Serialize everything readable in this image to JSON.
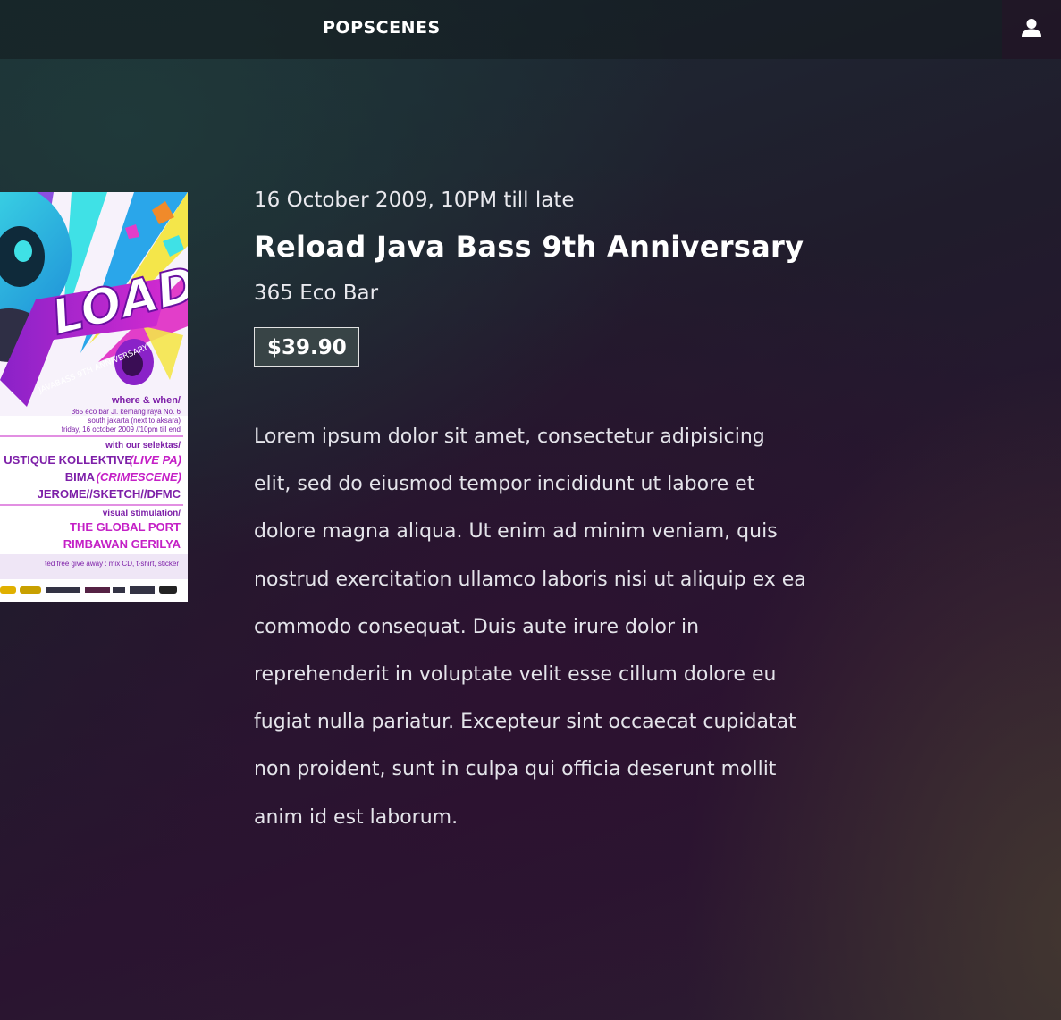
{
  "header": {
    "brand": "POPSCENES",
    "user_icon": "user-icon"
  },
  "event": {
    "date": "16 October 2009, 10PM till late",
    "title": "Reload Java Bass 9th Anniversary",
    "venue": "365 Eco Bar",
    "price": "$39.90",
    "description": "Lorem ipsum dolor sit amet, consectetur adipisicing elit, sed do eiusmod tempor incididunt ut labore et dolore magna aliqua. Ut enim ad minim veniam, quis nostrud exercitation ullamco laboris nisi ut aliquip ex ea commodo consequat. Duis aute irure dolor in reprehenderit in voluptate velit esse cillum dolore eu fugiat nulla pariatur. Excepteur sint occaecat cupidatat non proident, sunt in culpa qui officia deserunt mollit anim id est laborum."
  },
  "poster": {
    "headline": "LOAD",
    "subtitle": "JAVABASS 9TH ANNIVERSARY",
    "where_when_label": "where & when/",
    "where_line1": "365 eco bar Jl. kemang raya No. 6",
    "where_line2": "south jakarta (next to aksara)",
    "where_line3": "friday, 16 october 2009 //10pm till end",
    "selektas_label": "with our selektas/",
    "selekta_1": "USTIQUE KOLLEKTIVE",
    "selekta_1_note": "(LIVE PA)",
    "selekta_2": "BIMA",
    "selekta_2_note": "(CRIMESCENE)",
    "selekta_3": "JEROME//SKETCH//DFMC",
    "visual_label": "visual stimulation/",
    "visual_1": "THE GLOBAL PORT",
    "visual_2": "RIMBAWAN GERILYA",
    "giveaway": "ted free give away : mix CD, t-shirt, sticker",
    "colors": {
      "magenta": "#c41fc6",
      "cyan": "#3fe1e6",
      "yellow": "#f4e64a",
      "purple_text": "#7d1fa8"
    }
  }
}
